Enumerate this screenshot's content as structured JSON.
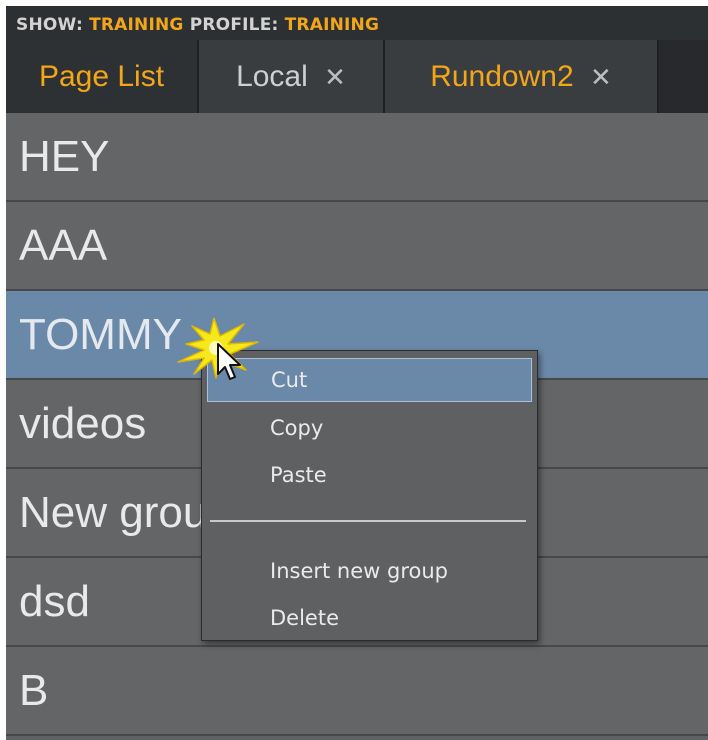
{
  "topbar": {
    "show_key": "SHOW:",
    "show_value": "TRAINING",
    "profile_key": "PROFILE:",
    "profile_value": "TRAINING"
  },
  "tabs": [
    {
      "label": "Page List",
      "closable": false,
      "color": "#f2a61a"
    },
    {
      "label": "Local",
      "closable": true,
      "color": "#cfcfcf"
    },
    {
      "label": "Rundown2",
      "closable": true,
      "color": "#f2a61a"
    }
  ],
  "tab_close_glyph": "✕",
  "list": {
    "items": [
      {
        "label": "HEY"
      },
      {
        "label": "AAA"
      },
      {
        "label": "TOMMY"
      },
      {
        "label": "videos"
      },
      {
        "label": "New group"
      },
      {
        "label": "dsd"
      },
      {
        "label": "B"
      }
    ],
    "selected_label": "TOMMY"
  },
  "context_menu": {
    "items": [
      {
        "label": "Cut",
        "highlighted": true
      },
      {
        "label": "Copy"
      },
      {
        "label": "Paste"
      },
      {
        "label": "Insert new group"
      },
      {
        "label": "Delete"
      }
    ]
  },
  "colors": {
    "accent_orange": "#f2a61a",
    "selection_blue": "#6a88a8",
    "row_bg": "#636567",
    "header_bg": "#2d3033"
  }
}
